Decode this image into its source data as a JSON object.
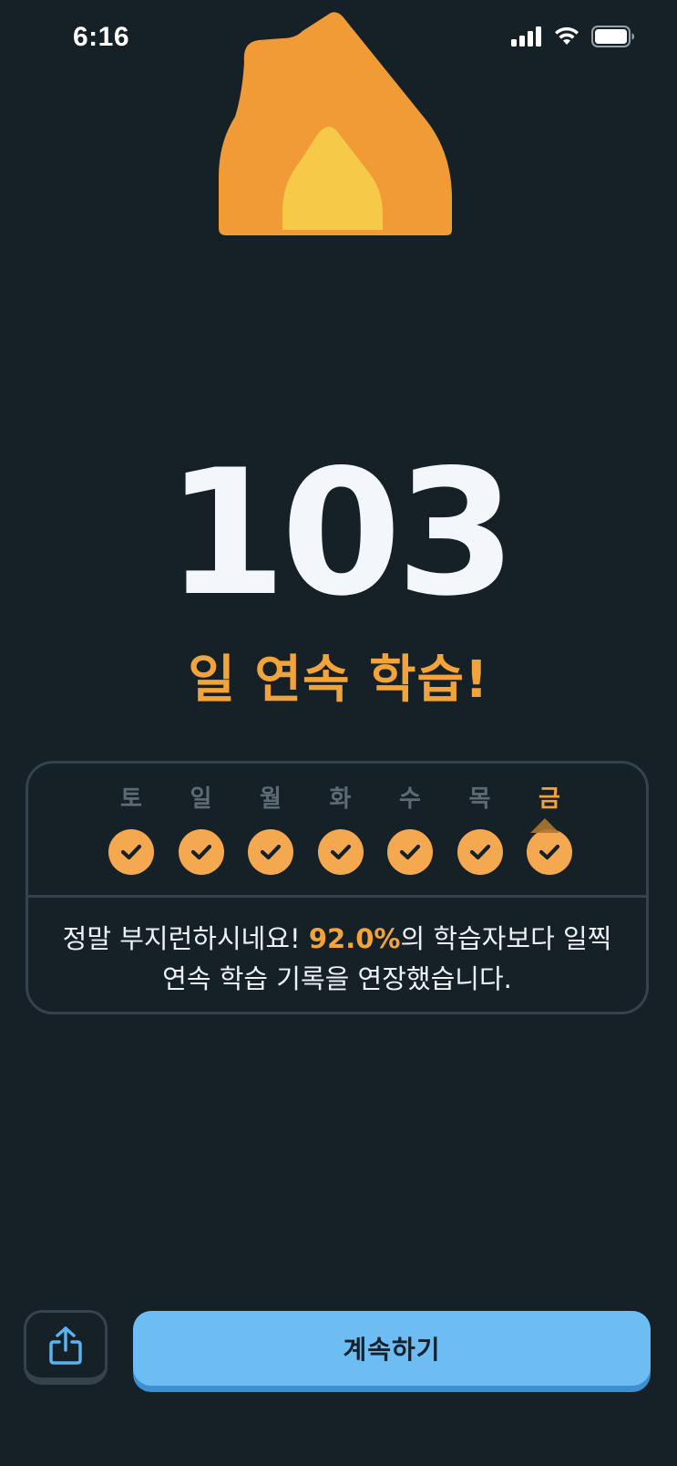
{
  "status_bar": {
    "time": "6:16"
  },
  "streak": {
    "count": "103",
    "label": "일 연속 학습!"
  },
  "week": {
    "days": [
      {
        "label": "토",
        "checked": true,
        "current": false
      },
      {
        "label": "일",
        "checked": true,
        "current": false
      },
      {
        "label": "월",
        "checked": true,
        "current": false
      },
      {
        "label": "화",
        "checked": true,
        "current": false
      },
      {
        "label": "수",
        "checked": true,
        "current": false
      },
      {
        "label": "목",
        "checked": true,
        "current": false
      },
      {
        "label": "금",
        "checked": true,
        "current": true
      }
    ],
    "message_prefix": "정말 부지런하시네요! ",
    "message_percent": "92.0%",
    "message_suffix_line1": "의 학습자보다 일찍",
    "message_line2": "연속 학습 기록을 연장했습니다."
  },
  "actions": {
    "continue_label": "계속하기"
  },
  "colors": {
    "background": "#162027",
    "accent_orange": "#f2a33a",
    "check_fill": "#f4a950",
    "button_blue": "#6dbdf3",
    "border": "#36424c"
  },
  "icons": {
    "share": "share-icon",
    "flame": "flame-icon",
    "check": "checkmark-icon"
  }
}
